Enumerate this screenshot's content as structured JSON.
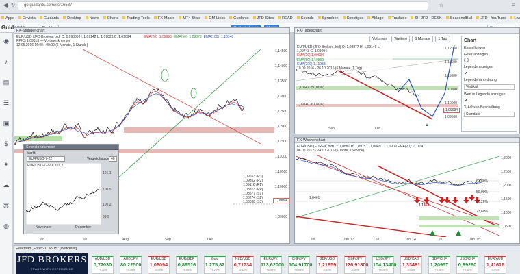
{
  "browser": {
    "url": "go.guidants.com/#c/16537",
    "bookmarks": [
      "Apps",
      "Onvista",
      "Guidants",
      "Desktop",
      "News",
      "Charts",
      "Trading-Tools",
      "FX-Makro",
      "MT4-Stats",
      "GM-Links",
      "Guidants",
      "JFD-Sites",
      "READ",
      "Sounds",
      "Sprachen",
      "Sonstiges",
      "Ablage",
      "Tradable",
      "6H JFD - DESK",
      "SeasonalBull",
      "JFD - YouTube",
      "Live - YouTube"
    ]
  },
  "app": {
    "logo": "Guidants",
    "desktop_tab": "Desktop",
    "login_label": "Brokerln Login",
    "market_label": "Markt",
    "search_label": "Suche"
  },
  "rail_icons": [
    "user-icon",
    "bell-icon",
    "chart-icon",
    "list-icon",
    "briefcase-icon",
    "dollar-icon",
    "bulb-icon",
    "cloud-icon",
    "tag-icon",
    "globe-icon"
  ],
  "panel_main": {
    "title": "FX-Stundenchart",
    "legend": [
      "EUR/USD (JFD Brokers, bid) O: 1,09885 H: 1,09142 L: 1,09823 C: 1,09094",
      "PP(C) 1,09813 — Vortageskmarker",
      "12.05.2016 16:00 - 09:00 (6 Monate, 1 Stunde)"
    ],
    "ema_labels": [
      "EMA(20)",
      "EMA(50)",
      "EMA(100)",
      "EMA(200)"
    ],
    "ema_values": [
      "1,09998",
      "1,09875",
      "1,10148",
      "1,09930"
    ],
    "y_ticks": [
      "1,14500",
      "1,14000",
      "1,13500",
      "1,13000",
      "1,12500",
      "1,12000",
      "1,11500",
      "1,11000",
      "1,10500",
      "1,10000",
      "1,09500",
      "1,09000"
    ],
    "pivot_labels": [
      "1,09653 (R3)",
      "1,09352 (R2)",
      "1,09116 (R1)",
      "1,08813 (PP)",
      "1,08577 (S1)",
      "1,08274 (S2)",
      "1,08038 (S3)"
    ],
    "last_price": "1,09094",
    "x_ticks": [
      "Jun",
      "Jul",
      "Aug",
      "Sep",
      "Okt"
    ]
  },
  "mini_chart": {
    "title": "Selektionsfenster",
    "field_label": "Markt",
    "field_value": "EUR/USD-7-22",
    "compare_label": "Vergleichstage",
    "compare_value": "40",
    "legend": "EUR/USD-7-22 = 101,2",
    "y_ticks": [
      "101,1",
      "100,5",
      "100,2",
      "99,9"
    ],
    "x_ticks": [
      "November",
      "Dezember"
    ]
  },
  "panel_daily": {
    "title": "FX-Tageschart",
    "toolbar": [
      "Volumen",
      "Weitere",
      "6 Monate",
      "1 Tag"
    ],
    "legend": [
      "EUR/USD (JFD Brokers, bid) O: 1,09877 H: 1,09146 L: 1,09743 C: 1,09094",
      "EMA(20) 1,09994",
      "EMA(50) 1,10899",
      "EMA(200) 1,11933",
      "10.09.2016 - 26.10.2016 (6 Monate, 1 Tag)"
    ],
    "levels": [
      "1,10647 (50,00%)",
      "1,09140 (61,80%)"
    ],
    "y_ticks": [
      "1,12000",
      "1,11500",
      "1,11000",
      "1,10500",
      "1,10000",
      "1,09500"
    ],
    "last_price": "1,09094",
    "x_ticks": [
      "Sep",
      "Okt"
    ]
  },
  "chart_settings": {
    "title": "Chart",
    "items": [
      "Einstellungen",
      "Gitter anzeigen",
      "Legende anzeigen",
      "Legendenanordnung",
      "Vertikal",
      "Wert in Legende anzeigen",
      "X-Achsen Beschriftung",
      "Standard"
    ]
  },
  "panel_weekly": {
    "title": "FX-Wochenchart",
    "legend": [
      "EUR/USD (FOREX, bid) O: 1,0881 H: 1,0915 L: 1,0849 C: 1,0909 EMA(20): 1,1114",
      "06.02.2012 - 24.10.2016 (5 Jahre, 1 Woche)"
    ],
    "fib_labels": [
      "61,80%",
      "50,00%",
      "38,20%",
      "23,60%",
      "1,0461"
    ],
    "price_tag": "1,1453",
    "y_ticks": [
      "1,3000",
      "1,2500",
      "1,2000",
      "1,1500",
      "1,1000",
      "1,0500"
    ],
    "x_ticks": [
      "Jul",
      "Jan '13",
      "Jul",
      "Jan '14",
      "Jul",
      "Jan '15"
    ]
  },
  "watchlist": {
    "title": "Heatmap „Forex-TOP-15\" [Watchlist]",
    "brand": "JFD BROKERS",
    "brand_tagline": "TRADE WITH EXPERIENCE",
    "tiles": [
      {
        "name": "AUD/USD",
        "value": "0,77030",
        "change": "+0,11%",
        "dir": "up"
      },
      {
        "name": "AUD/JPY",
        "value": "80,22500",
        "change": "+0,15%",
        "dir": "up"
      },
      {
        "name": "EUR/USD",
        "value": "1,09094",
        "change": "-0,02%",
        "dir": "dn"
      },
      {
        "name": "EUR/GBP",
        "value": "0,89516",
        "change": "+0,05%",
        "dir": "up"
      },
      {
        "name": "Gold",
        "value": "1.275,82",
        "change": "+0,21%",
        "dir": "up"
      },
      {
        "name": "NZD/USD",
        "value": "0,71734",
        "change": "-0,12%",
        "dir": "dn"
      },
      {
        "name": "EUR/JPY",
        "value": "113,62000",
        "change": "+0,09%",
        "dir": "up"
      },
      {
        "name": "CHF/JPY",
        "value": "104,91700",
        "change": "+0,04%",
        "dir": "up"
      },
      {
        "name": "GBP/USD",
        "value": "1,21859",
        "change": "-0,14%",
        "dir": "dn"
      },
      {
        "name": "GBP/JPY",
        "value": "126,91800",
        "change": "-0,08%",
        "dir": "dn"
      },
      {
        "name": "USD/JPY",
        "value": "104,13400",
        "change": "+0,10%",
        "dir": "up"
      },
      {
        "name": "USD/CAD",
        "value": "1,33481",
        "change": "-0,03%",
        "dir": "dn"
      },
      {
        "name": "GBP/CHF",
        "value": "1,20957",
        "change": "+0,06%",
        "dir": "up"
      },
      {
        "name": "USD/CHF",
        "value": "0,99260",
        "change": "+0,02%",
        "dir": "up"
      },
      {
        "name": "EUR/AUD",
        "value": "1,41616",
        "change": "-0,07%",
        "dir": "dn"
      }
    ]
  },
  "colors": {
    "up": "#1d8a35",
    "down": "#c7282e",
    "accent": "#3b7fd1",
    "ema20": "#d42a2a",
    "ema50": "#2e9e45",
    "ema100": "#3157c8"
  }
}
